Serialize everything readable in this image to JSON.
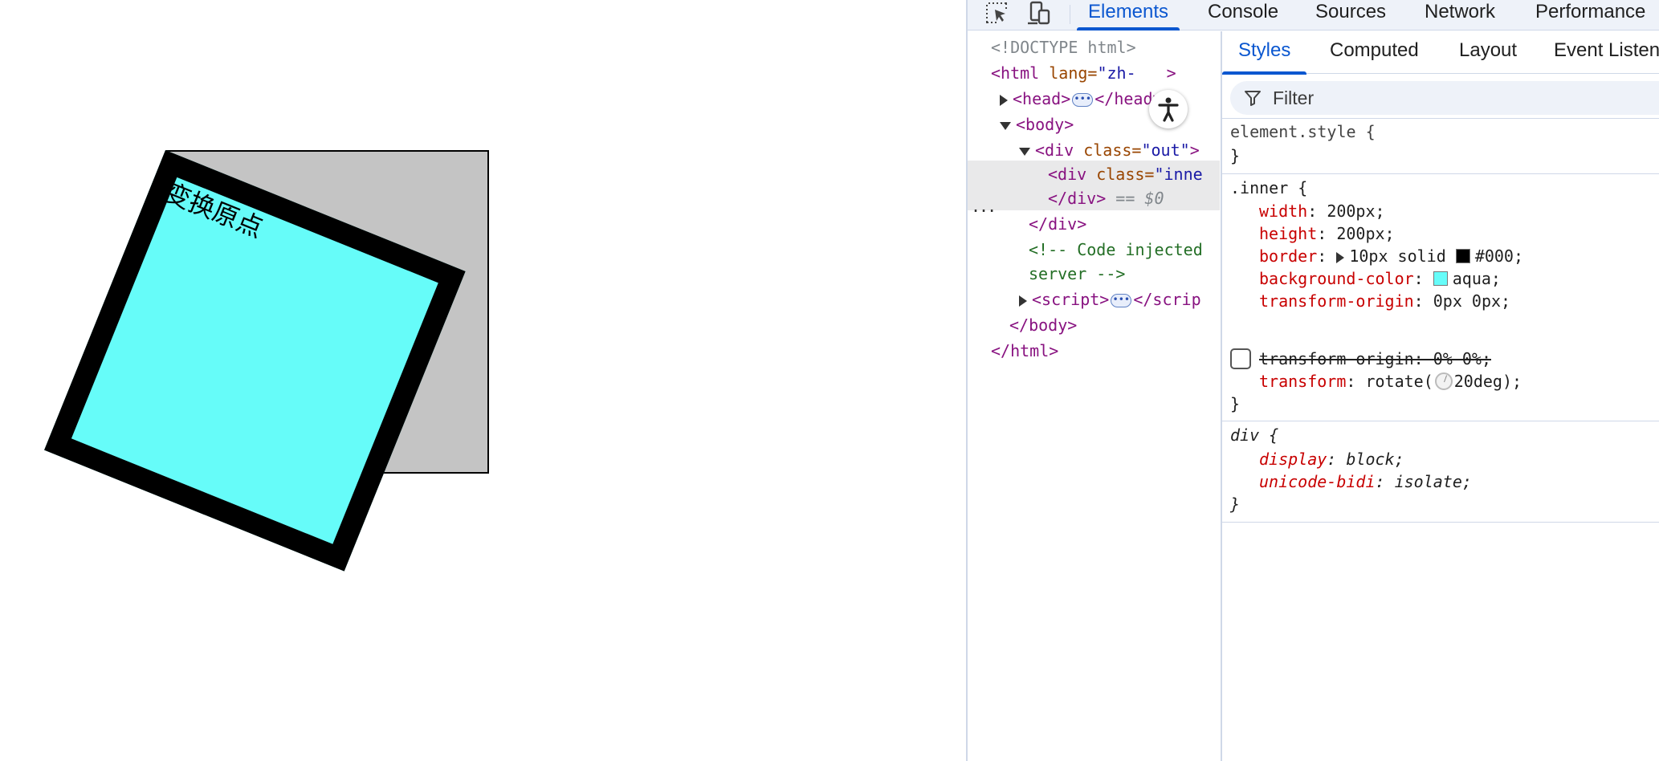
{
  "page": {
    "inner_text": "变换原点"
  },
  "devtools": {
    "toolbar": {
      "icons": [
        "inspect-element-icon",
        "device-toolbar-icon"
      ],
      "tabs": [
        "Elements",
        "Console",
        "Sources",
        "Network",
        "Performance"
      ],
      "active_tab": "Elements"
    },
    "dom": {
      "doctype": "<!DOCTYPE html>",
      "html_open_tag": "<html",
      "html_lang_attr": " lang=",
      "html_lang_value": "\"zh-",
      "html_close_bracket": ">",
      "head_open": "<head>",
      "head_close": "</head>",
      "body_open": "<body>",
      "div_out_open": "<div",
      "div_out_attr": " class=",
      "div_out_value": "\"out\"",
      "div_out_bracket": ">",
      "div_inner_open": "<div",
      "div_inner_attr": " class=",
      "div_inner_value": "\"inne",
      "div_inner_close": "</div>",
      "selected_marker": "== $0",
      "div_out_close": "</div>",
      "comment_line1": "<!-- Code injected",
      "comment_line2": "server -->",
      "script_open": "<script>",
      "script_close": "</scrip",
      "body_close": "</body>",
      "html_close": "</html>",
      "ellipsis": "..."
    },
    "styles": {
      "subtabs": [
        "Styles",
        "Computed",
        "Layout",
        "Event Listeners"
      ],
      "active_subtab": "Styles",
      "filter_placeholder": "Filter",
      "element_style_selector": "element.style {",
      "close_brace": "}",
      "inner_selector": ".inner {",
      "inner_rules": {
        "width_prop": "width",
        "width_val": "200px;",
        "height_prop": "height",
        "height_val": "200px;",
        "border_prop": "border",
        "border_val": "10px solid",
        "border_color": "#000;",
        "bg_prop": "background-color",
        "bg_val": "aqua;",
        "origin_prop": "transform-origin",
        "origin_val": "0px 0px;",
        "origin_disabled": "transform-origin: 0% 0%;",
        "transform_prop": "transform",
        "transform_val_prefix": "rotate(",
        "transform_val_suffix": "20deg);"
      },
      "div_selector": "div {",
      "div_rules": {
        "display_prop": "display",
        "display_val": "block;",
        "bidi_prop": "unicode-bidi",
        "bidi_val": "isolate;"
      }
    }
  },
  "colors": {
    "outer_bg": "#c4c4c4",
    "inner_bg": "#66fcf9",
    "inner_border": "#000000",
    "accent": "#0b57d0",
    "swatch_aqua": "#00ffff",
    "swatch_black": "#000000"
  }
}
